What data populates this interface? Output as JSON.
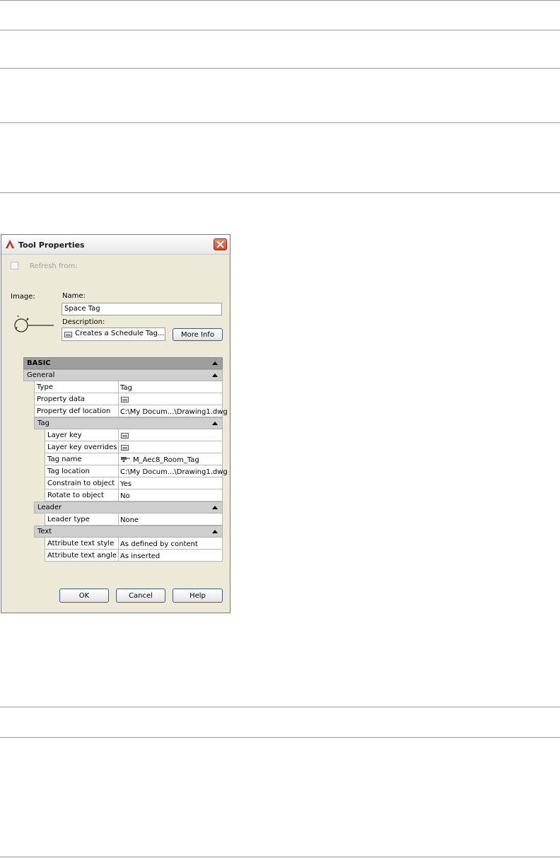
{
  "dialog": {
    "title": "Tool Properties",
    "refresh_label": "Refresh from:",
    "image_label": "Image:",
    "name_label": "Name:",
    "name_value": "Space Tag",
    "description_label": "Description:",
    "description_value": "Creates a Schedule Tag...",
    "more_info_label": "More Info",
    "ok_label": "OK",
    "cancel_label": "Cancel",
    "help_label": "Help"
  },
  "grid": {
    "basic": "BASIC",
    "general": {
      "label": "General",
      "type": {
        "name": "Type",
        "value": "Tag"
      },
      "property_data": {
        "name": "Property data",
        "value": ""
      },
      "property_def_location": {
        "name": "Property def location",
        "value": "C:\\My Docum...\\Drawing1.dwg"
      }
    },
    "tag": {
      "label": "Tag",
      "layer_key": {
        "name": "Layer key",
        "value": ""
      },
      "layer_key_overrides": {
        "name": "Layer key overrides",
        "value": ""
      },
      "tag_name": {
        "name": "Tag name",
        "value": "M_Aec8_Room_Tag"
      },
      "tag_location": {
        "name": "Tag location",
        "value": "C:\\My Docum...\\Drawing1.dwg"
      },
      "constrain_to_object": {
        "name": "Constrain to object",
        "value": "Yes"
      },
      "rotate_to_object": {
        "name": "Rotate to object",
        "value": "No"
      }
    },
    "leader": {
      "label": "Leader",
      "leader_type": {
        "name": "Leader type",
        "value": "None"
      }
    },
    "text": {
      "label": "Text",
      "attribute_text_style": {
        "name": "Attribute text style",
        "value": "As defined by content"
      },
      "attribute_text_angle": {
        "name": "Attribute text angle",
        "value": "As inserted"
      }
    }
  },
  "colors": {
    "dialog_bg": "#ece9d8",
    "section_header": "#9e9e9e",
    "subsection_header": "#cfcfcf",
    "close_button": "#d0452a"
  },
  "icons": [
    "app-icon",
    "close-icon",
    "tag-preview-icon",
    "document-icon",
    "block-icon",
    "collapse-triangle-icon"
  ]
}
